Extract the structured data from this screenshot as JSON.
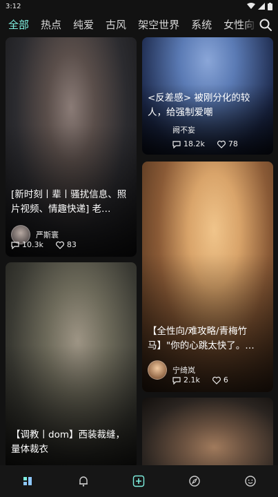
{
  "status": {
    "time": "3:12"
  },
  "tabs": [
    {
      "label": "全部",
      "active": true
    },
    {
      "label": "热点",
      "active": false
    },
    {
      "label": "纯爱",
      "active": false
    },
    {
      "label": "古风",
      "active": false
    },
    {
      "label": "架空世界",
      "active": false
    },
    {
      "label": "系统",
      "active": false
    },
    {
      "label": "女性向",
      "active": false
    }
  ],
  "cards": [
    {
      "title": "[新时刻丨辈丨骚扰信息、照片视频、情趣快递] 老…",
      "author": "严斯寰",
      "views": "10.3k",
      "likes": "83",
      "colors": {
        "a": "#2b2b2f",
        "b": "#5a4e4a"
      }
    },
    {
      "title": "<反差感> 被刚分化的较人，给强制爱嘲",
      "author": "阙不妄",
      "views": "18.2k",
      "likes": "78",
      "colors": {
        "a": "#1d2a4d",
        "b": "#5b7bb5"
      }
    },
    {
      "title": "【调教丨dom】西装裁缝，量体裁衣",
      "author": "",
      "views": "",
      "likes": "",
      "colors": {
        "a": "#3a3a33",
        "b": "#6d6a5a"
      }
    },
    {
      "title": "【全性向/难攻略/青梅竹马】\"你的心跳太快了。…",
      "author": "宁绮岚",
      "views": "2.1k",
      "likes": "6",
      "colors": {
        "a": "#5a3a22",
        "b": "#d9a46a"
      }
    },
    {
      "title": "",
      "author": "",
      "views": "",
      "likes": "",
      "colors": {
        "a": "#2a2420",
        "b": "#6b5240"
      }
    }
  ],
  "nav": [
    "home-icon",
    "bell-icon",
    "create-icon",
    "compass-icon",
    "profile-icon"
  ],
  "accent": "#7ef0e0"
}
